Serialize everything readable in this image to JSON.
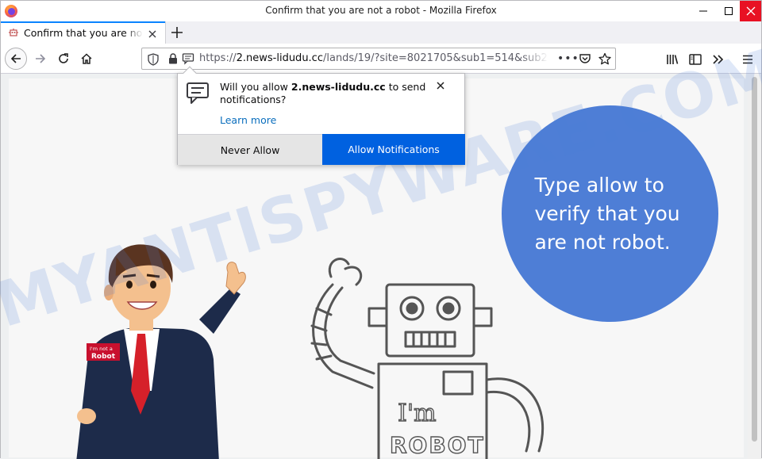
{
  "window": {
    "title": "Confirm that you are not a robot - Mozilla Firefox"
  },
  "tab": {
    "title": "Confirm that you are not a robot"
  },
  "urlbar": {
    "scheme": "https://",
    "host": "2.news-lidudu.cc",
    "path": "/lands/19/?site=8021705&sub1=514&sub2="
  },
  "popup": {
    "text_prefix": "Will you allow ",
    "text_site": "2.news-lidudu.cc",
    "text_suffix": " to send notifications?",
    "learn_more": "Learn more",
    "never_allow": "Never Allow",
    "allow_notifications": "Allow Notifications"
  },
  "page": {
    "bubble_text": "Type allow to verify that you are not robot.",
    "badge_line1": "I'm not a",
    "badge_line2": "Robot",
    "robot_line1": "I'm",
    "robot_line2": "ROBOT"
  },
  "watermark": "MYANTISPYWARE.COM",
  "colors": {
    "accent": "#0a84ff",
    "allow_button": "#0061e0",
    "bubble": "#4e7ed6",
    "close_button": "#e81123"
  }
}
